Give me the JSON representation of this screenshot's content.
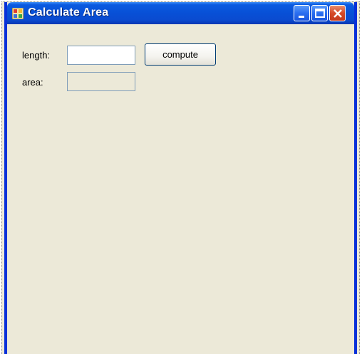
{
  "window": {
    "title": "Calculate Area",
    "controls": {
      "minimize_icon": "minimize-icon",
      "maximize_icon": "maximize-icon",
      "close_icon": "close-icon"
    },
    "colors": {
      "titlebar": "#0a5ae0",
      "client_background": "#ece9d8",
      "close_button": "#d64a27"
    }
  },
  "form": {
    "length_label": "length:",
    "length_value": "",
    "compute_label": "compute",
    "area_label": "area:",
    "area_value": ""
  }
}
